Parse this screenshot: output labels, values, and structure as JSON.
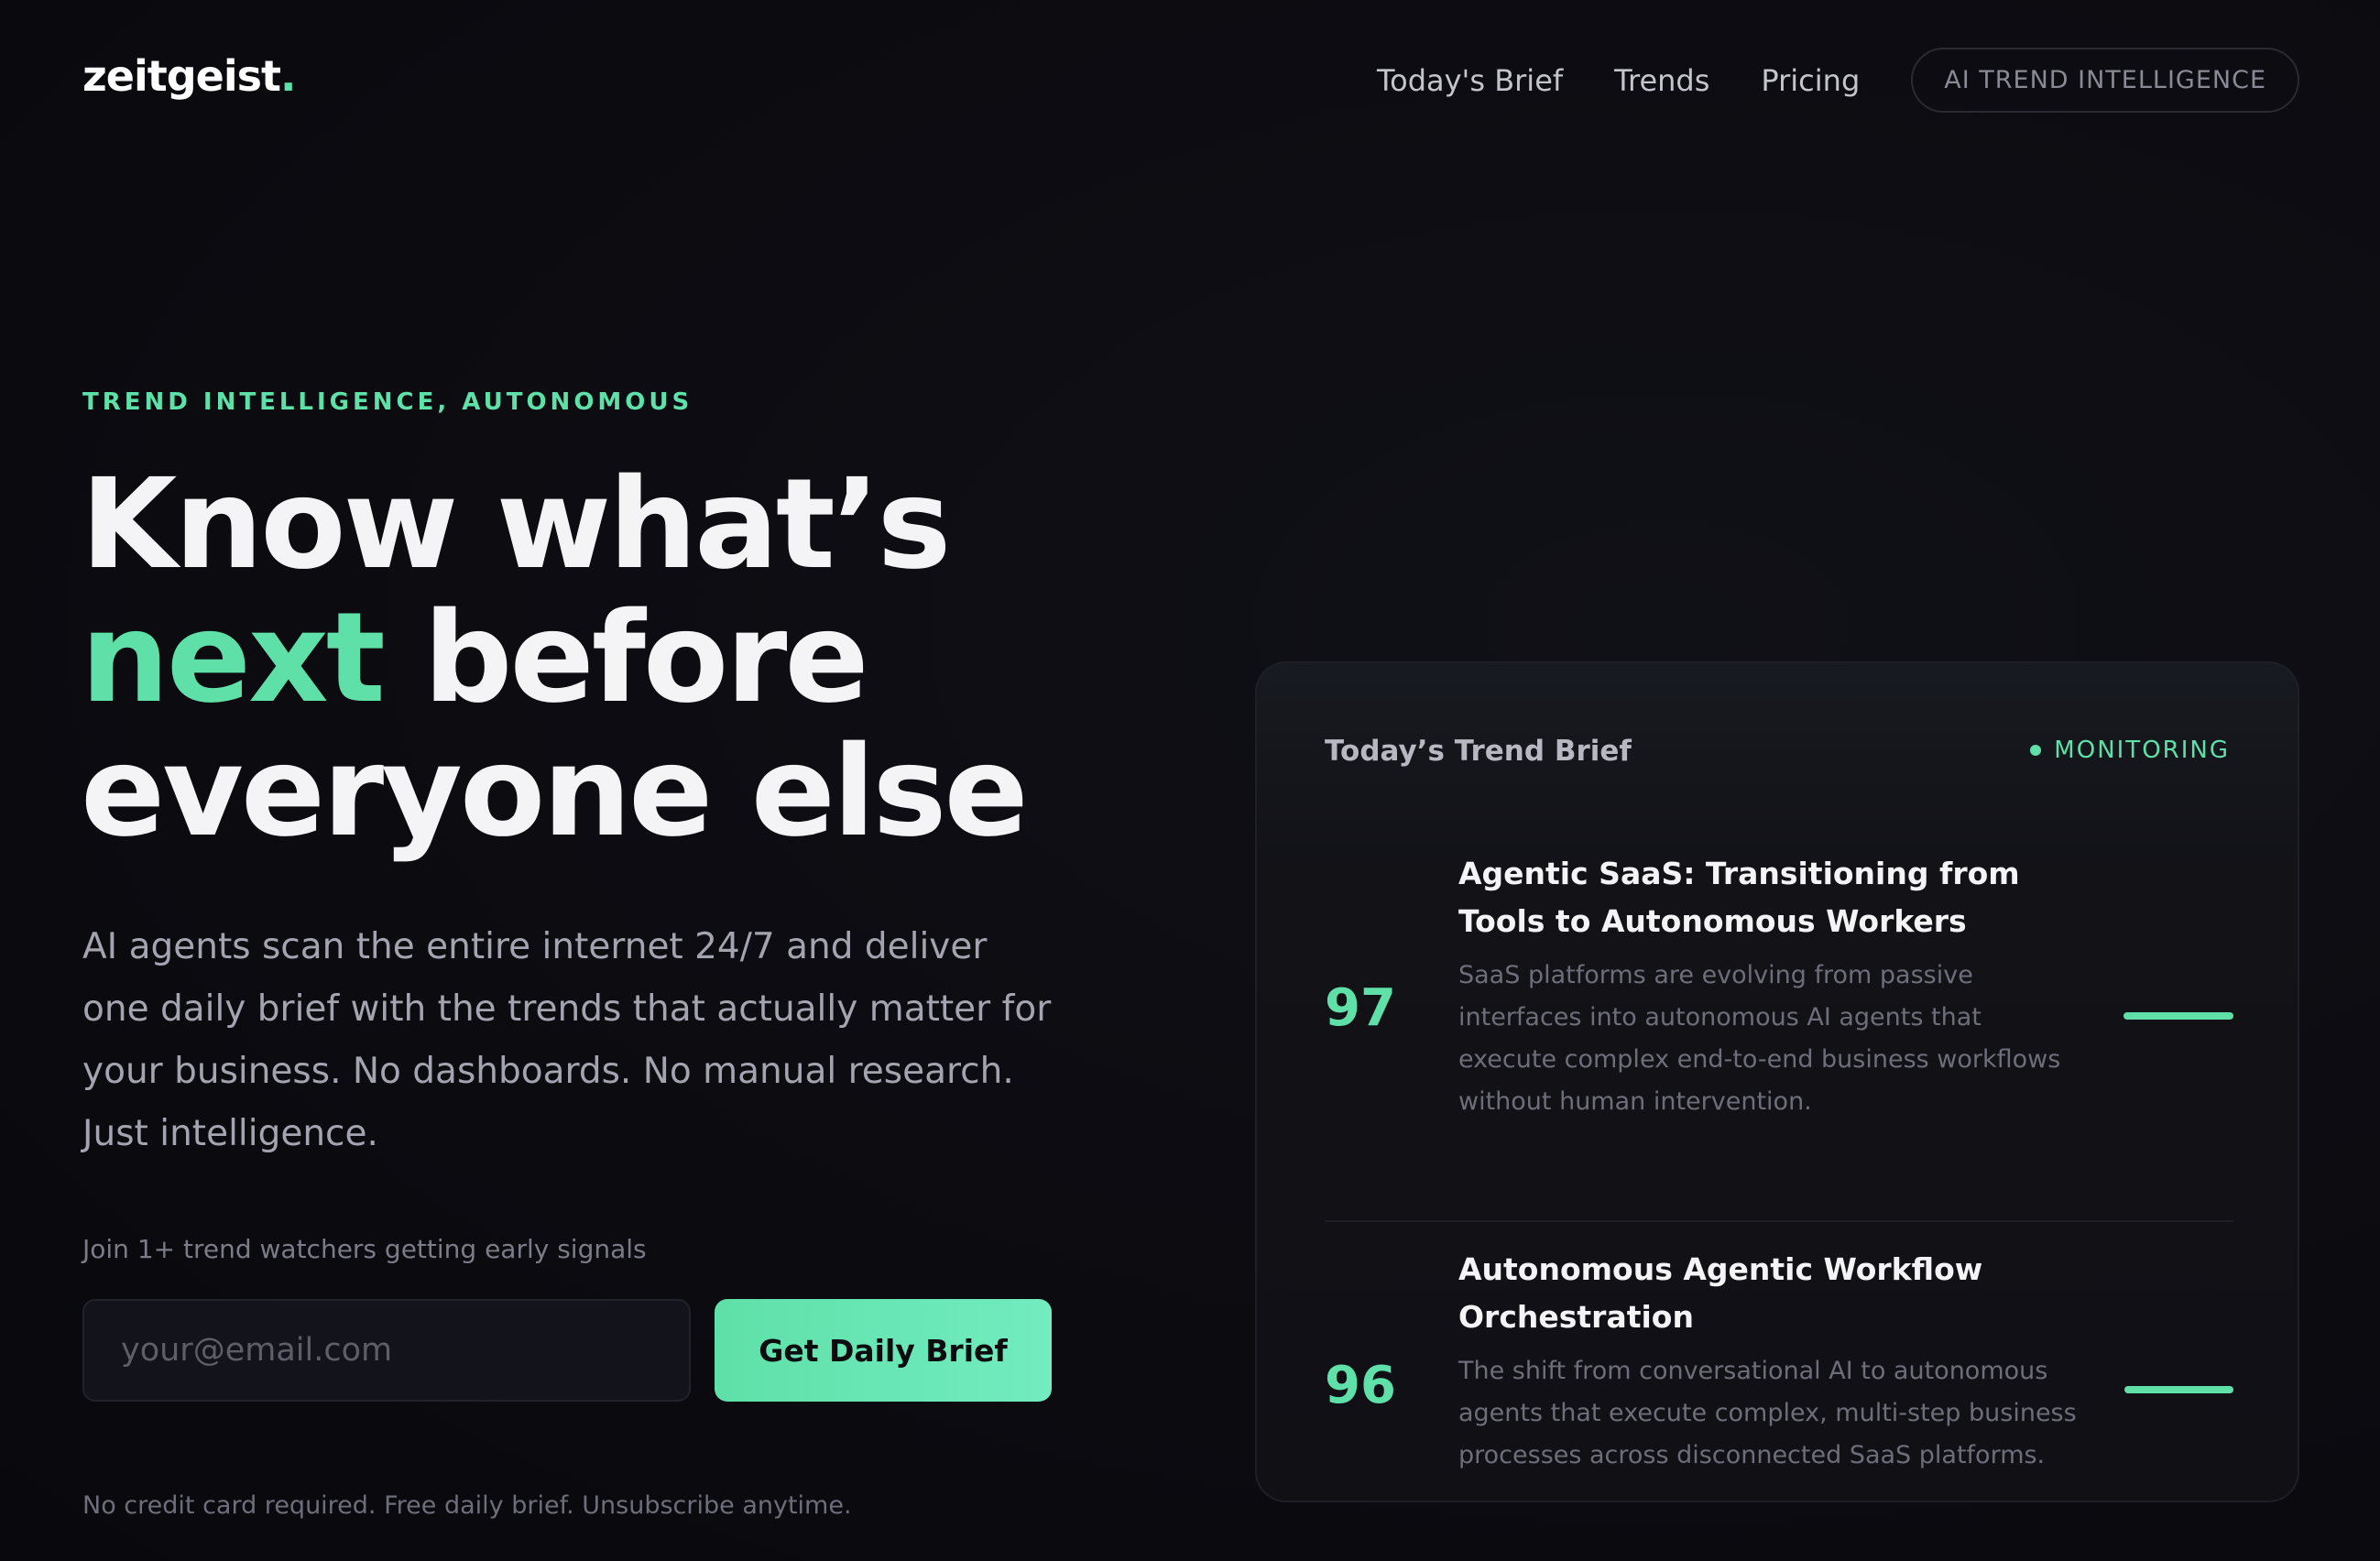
{
  "brand": {
    "name": "zeitgeist",
    "dot": "."
  },
  "nav": {
    "links": [
      "Today's Brief",
      "Trends",
      "Pricing"
    ],
    "pill": "AI TREND INTELLIGENCE"
  },
  "hero": {
    "eyebrow": "TREND INTELLIGENCE, AUTONOMOUS",
    "headline_pre": "Know what’s ",
    "headline_accent": "next",
    "headline_post": " before everyone else",
    "lede": "AI agents scan the entire internet 24/7 and deliver one daily brief with the trends that actually matter for your business. No dashboards. No manual research. Just intelligence.",
    "join_text": "Join 1+ trend watchers getting early signals",
    "email_placeholder": "your@email.com",
    "cta_label": "Get Daily Brief",
    "fine_print": "No credit card required. Free daily brief. Unsubscribe anytime."
  },
  "brief": {
    "title": "Today’s Trend Brief",
    "status": "MONITORING",
    "items": [
      {
        "score": "97",
        "score_fraction": 0.97,
        "title": "Agentic SaaS: Transitioning from Tools to Autonomous Workers",
        "description": "SaaS platforms are evolving from passive interfaces into autonomous AI agents that execute complex end-to-end business workflows without human intervention."
      },
      {
        "score": "96",
        "score_fraction": 0.96,
        "title": "Autonomous Agentic Workflow Orchestration",
        "description": "The shift from conversational AI to autonomous agents that execute complex, multi-step business processes across disconnected SaaS platforms."
      }
    ]
  },
  "colors": {
    "accent": "#5fe0a8",
    "background": "#0c0c11",
    "card": "#121217"
  }
}
